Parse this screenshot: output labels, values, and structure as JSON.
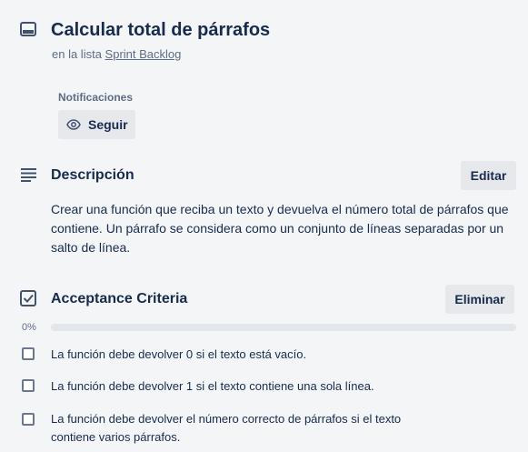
{
  "card": {
    "title": "Calcular total de párrafos",
    "list_prefix": "en la lista",
    "list_name": "Sprint Backlog"
  },
  "notifications": {
    "label": "Notificaciones",
    "follow_label": "Seguir"
  },
  "description": {
    "title": "Descripción",
    "edit_label": "Editar",
    "text": "Crear una función que reciba un texto y devuelva el número total de párrafos que contiene. Un párrafo se considera como un conjunto de líneas separadas por un salto de línea."
  },
  "checklist": {
    "title": "Acceptance Criteria",
    "delete_label": "Eliminar",
    "progress_label": "0%",
    "progress_fraction": 0,
    "items": [
      {
        "text": "La función debe devolver 0 si el texto está vacío.",
        "checked": false
      },
      {
        "text": "La función debe devolver 1 si el texto contiene una sola línea.",
        "checked": false
      },
      {
        "text": "La función debe devolver el número correcto de párrafos si el texto contiene varios párrafos.",
        "checked": false
      }
    ]
  },
  "icons": {
    "card": "card-icon",
    "eye": "eye-icon",
    "description": "description-lines-icon",
    "checklist": "checkbox-icon"
  },
  "colors": {
    "background": "#f4f5f7",
    "button": "#e6e8ec",
    "text": "#172b4d",
    "muted": "#5e6c84"
  }
}
